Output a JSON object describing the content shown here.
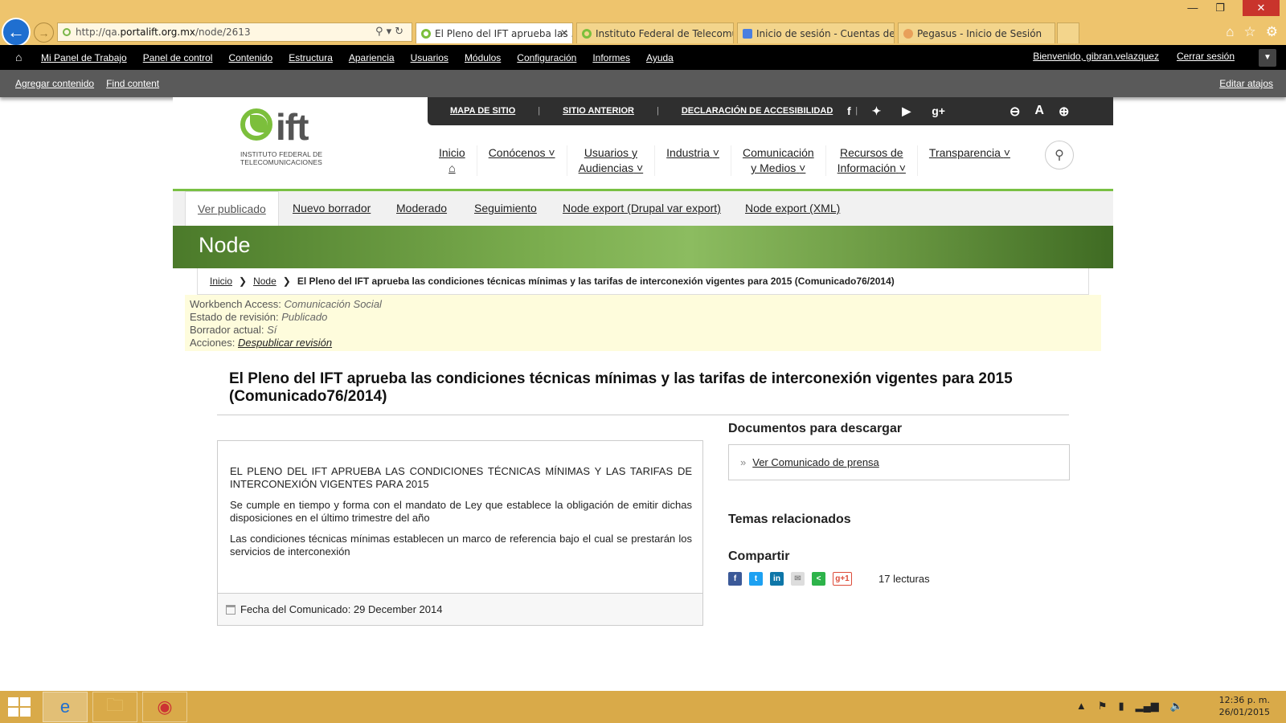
{
  "browser": {
    "url_prefix": "http://qa.",
    "url_domain": "portalift.org.mx",
    "url_path": "/node/2613",
    "tabs": [
      {
        "label": "El Pleno del IFT aprueba las ...",
        "active": true
      },
      {
        "label": "Instituto Federal de Telecomu...",
        "active": false
      },
      {
        "label": "Inicio de sesión - Cuentas de G...",
        "active": false
      },
      {
        "label": "Pegasus - Inicio de Sesión",
        "active": false
      }
    ]
  },
  "admin_toolbar": {
    "menu": [
      "Mi Panel de Trabajo",
      "Panel de control",
      "Contenido",
      "Estructura",
      "Apariencia",
      "Usuarios",
      "Módulos",
      "Configuración",
      "Informes",
      "Ayuda"
    ],
    "welcome": "Bienvenido, gibran.velazquez",
    "logout": "Cerrar sesión",
    "shortcuts": [
      "Agregar contenido",
      "Find content"
    ],
    "edit_shortcuts": "Editar atajos"
  },
  "site": {
    "logo_word": "ift",
    "logo_sub_1": "INSTITUTO FEDERAL DE",
    "logo_sub_2": "TELECOMUNICACIONES",
    "util_links": [
      "MAPA DE SITIO",
      "SITIO ANTERIOR",
      "DECLARACIÓN DE ACCESIBILIDAD"
    ],
    "nav": [
      {
        "l1": "Inicio",
        "l2": ""
      },
      {
        "l1": "Conócenos",
        "l2": ""
      },
      {
        "l1": "Usuarios y",
        "l2": "Audiencias"
      },
      {
        "l1": "Industria",
        "l2": ""
      },
      {
        "l1": "Comunicación",
        "l2": "y Medios"
      },
      {
        "l1": "Recursos de",
        "l2": "Información"
      },
      {
        "l1": "Transparencia",
        "l2": ""
      }
    ]
  },
  "local_tabs": [
    "Ver publicado",
    "Nuevo borrador",
    "Moderado",
    "Seguimiento",
    "Node export (Drupal var export)",
    "Node export (XML)"
  ],
  "banner_title": "Node",
  "breadcrumb": {
    "home": "Inicio",
    "node": "Node",
    "current": "El Pleno del IFT aprueba las condiciones técnicas mínimas y las tarifas de interconexión vigentes para 2015 (Comunicado76/2014)"
  },
  "workbench": {
    "access_label": "Workbench Access:",
    "access_value": "Comunicación Social",
    "state_label": "Estado de revisión:",
    "state_value": "Publicado",
    "draft_label": "Borrador actual:",
    "draft_value": "Sí",
    "actions_label": "Acciones:",
    "actions_link": "Despublicar revisión"
  },
  "article": {
    "title": "El Pleno del IFT aprueba las condiciones técnicas mínimas y las tarifas de interconexión vigentes para 2015 (Comunicado76/2014)",
    "paragraphs": [
      "EL PLENO DEL IFT APRUEBA LAS CONDICIONES TÉCNICAS MÍNIMAS Y LAS TARIFAS DE INTERCONEXIÓN VIGENTES PARA 2015",
      "Se cumple en tiempo y forma con el mandato de Ley que establece la obligación de emitir dichas disposiciones en el último trimestre del año",
      "Las condiciones técnicas mínimas establecen un marco de referencia bajo el cual se prestarán los servicios de interconexión"
    ],
    "date_label": "Fecha del Comunicado: 29 December 2014"
  },
  "sidebar": {
    "docs_heading": "Documentos para descargar",
    "doc_link": "Ver Comunicado de prensa",
    "related_heading": "Temas relacionados",
    "share_heading": "Compartir",
    "reads": "17 lecturas"
  },
  "taskbar": {
    "time": "12:36 p. m.",
    "date": "26/01/2015"
  }
}
